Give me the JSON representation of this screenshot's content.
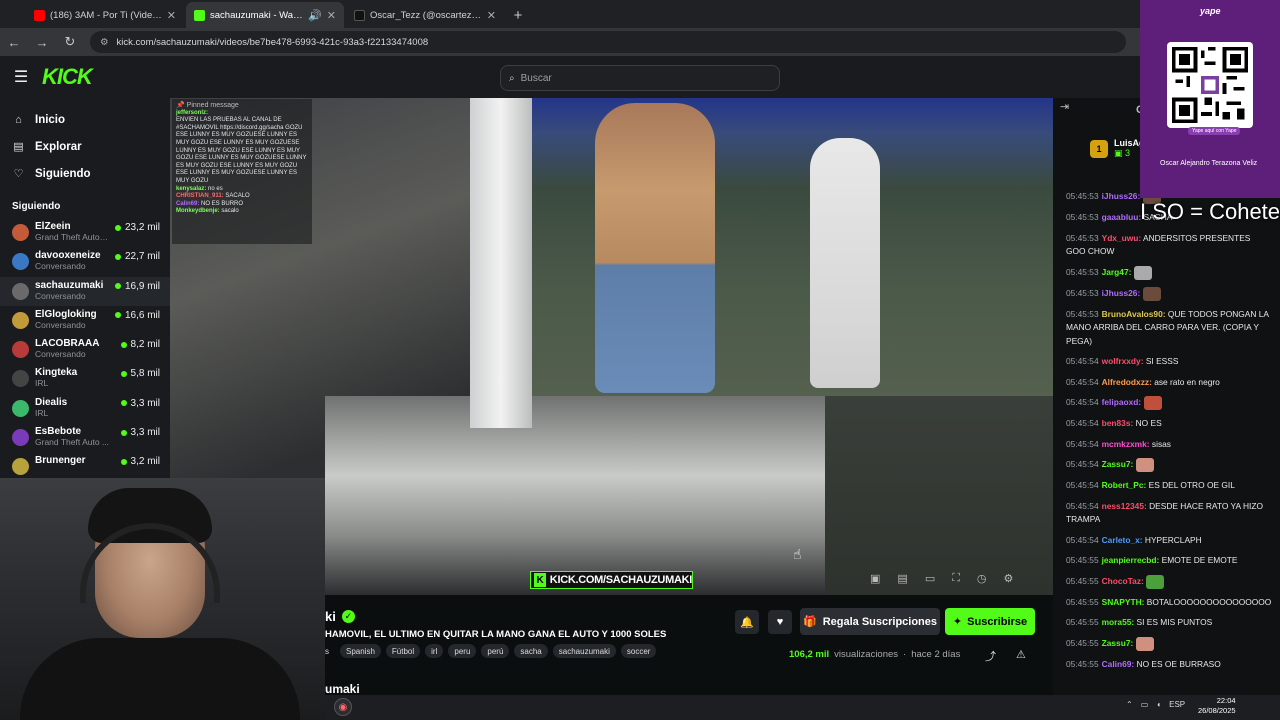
{
  "browser": {
    "tabs": [
      {
        "label": "(186) 3AM - Por Ti (Video Oficial)",
        "color": "#ff0000"
      },
      {
        "label": "sachauzumaki - Watch the",
        "color": "#53fc18"
      },
      {
        "label": "Oscar_Tezz (@oscartezz_) | TikTok",
        "color": "#111111"
      }
    ],
    "url": "kick.com/sachauzumaki/videos/be7be478-6993-421c-93a3-f22133474008"
  },
  "header": {
    "logo": "KICK",
    "search_placeholder": "Buscar"
  },
  "sidebar": {
    "nav": [
      {
        "label": "Inicio",
        "icon": "home-icon"
      },
      {
        "label": "Explorar",
        "icon": "compass-icon"
      },
      {
        "label": "Siguiendo",
        "icon": "heart-icon"
      }
    ],
    "section_title": "Siguiendo",
    "channels": [
      {
        "name": "ElZeein",
        "sub": "Grand Theft Auto ...",
        "viewers": "23,2 mil",
        "color": "#c35b3b"
      },
      {
        "name": "davooxeneize",
        "sub": "Conversando",
        "viewers": "22,7 mil",
        "color": "#3b78c3"
      },
      {
        "name": "sachauzumaki",
        "sub": "Conversando",
        "viewers": "16,9 mil",
        "color": "#6a6a6a"
      },
      {
        "name": "ElGlogloking",
        "sub": "Conversando",
        "viewers": "16,6 mil",
        "color": "#c39a3b"
      },
      {
        "name": "LACOBRAAA",
        "sub": "Conversando",
        "viewers": "8,2 mil",
        "color": "#b83b3b"
      },
      {
        "name": "Kingteka",
        "sub": "IRL",
        "viewers": "5,8 mil",
        "color": "#444444"
      },
      {
        "name": "Diealis",
        "sub": "IRL",
        "viewers": "3,3 mil",
        "color": "#3bb86a"
      },
      {
        "name": "EsBebote",
        "sub": "Grand Theft Auto ...",
        "viewers": "3,3 mil",
        "color": "#7b3bb8"
      },
      {
        "name": "Brunenger",
        "sub": "",
        "viewers": "3,2 mil",
        "color": "#b8a23b"
      }
    ]
  },
  "pinned": {
    "title": "Pinned message",
    "user": "jeffersonlz:",
    "text": "ENVIEN LAS PRUEBAS AL CANAL DE #SACHAMOVIL https://discord.gg/sacha GOZU ESE LUNNY ES MUY GOZUESE LUNNY ES MUY GOZU ESE LUNNY ES MUY GOZUESE LUNNY ES MUY GOZU ESE LUNNY ES MUY GOZU ESE LUNNY ES MUY GOZUESE LUNNY ES MUY GOZU ESE LUNNY ES MUY GOZU ESE LUNNY ES MUY GOZUESE LUNNY ES MUY GOZU",
    "extra": [
      {
        "user": "kenysalaz:",
        "text": "no es"
      },
      {
        "user": "CHRISTIAN_911:",
        "text": "SACALO"
      },
      {
        "user": "Calin69:",
        "text": "NO ES BURRO"
      },
      {
        "user": "Monkeydbenje:",
        "text": "sacalo"
      }
    ]
  },
  "video": {
    "watermark": "KICK.COM/SACHAUZUMAKI"
  },
  "stream": {
    "streamer": "ki",
    "title": "HAMOVIL, EL ULTIMO EN QUITAR LA MANO GANA EL AUTO Y 1000 SOLES",
    "tags": [
      "s",
      "Spanish",
      "Fútbol",
      "irl",
      "peru",
      "perú",
      "sacha",
      "sachauzumaki",
      "soccer"
    ],
    "gift_label": "Regala Suscripciones",
    "subscribe_label": "Suscribirse",
    "views": "106,2 mil",
    "views_label": "visualizaciones",
    "age": "hace 2 días",
    "bottom_name": "umaki"
  },
  "chat": {
    "top_label": "C",
    "pinned_user": "LuisAg",
    "pinned_count": "3",
    "messages": [
      {
        "ts": "05:45:53",
        "user": "iJhuss26:",
        "text": "",
        "color": "#b26bff",
        "emote": "#6b4b3b"
      },
      {
        "ts": "05:45:53",
        "user": "gaaabluu:",
        "text": "SACHA",
        "color": "#b26bff"
      },
      {
        "ts": "05:45:53",
        "user": "Ydx_uwu:",
        "text": "ANDERSITOS PRESENTES GOO CHOW",
        "color": "#ff4b6b"
      },
      {
        "ts": "05:45:53",
        "user": "Jarg47:",
        "text": "",
        "color": "#53fc18",
        "emote": "#aaaaaa"
      },
      {
        "ts": "05:45:53",
        "user": "iJhuss26:",
        "text": "",
        "color": "#b26bff",
        "emote": "#6b4b3b"
      },
      {
        "ts": "05:45:53",
        "user": "BrunoAvalos90:",
        "text": "QUE TODOS PONGAN LA MANO ARRIBA DEL CARRO PARA VER. (COPIA Y PEGA)",
        "color": "#e0c84b"
      },
      {
        "ts": "05:45:54",
        "user": "wolfrxxdy:",
        "text": "SI ESSS",
        "color": "#ff4b6b"
      },
      {
        "ts": "05:45:54",
        "user": "Alfredodxzz:",
        "text": "ase rato en negro",
        "color": "#ff9b4b"
      },
      {
        "ts": "05:45:54",
        "user": "felipaoxd:",
        "text": "",
        "color": "#b26bff",
        "emote": "#c0503b"
      },
      {
        "ts": "05:45:54",
        "user": "ben83s:",
        "text": "NO ES",
        "color": "#ff4b6b"
      },
      {
        "ts": "05:45:54",
        "user": "mcmkzxmk:",
        "text": "sisas",
        "color": "#ff4bd0"
      },
      {
        "ts": "05:45:54",
        "user": "Zassu7:",
        "text": "",
        "color": "#53fc18",
        "emote": "#d09080"
      },
      {
        "ts": "05:45:54",
        "user": "Robert_Pc:",
        "text": "ES DEL OTRO OE GIL",
        "color": "#53fc18"
      },
      {
        "ts": "05:45:54",
        "user": "ness12345:",
        "text": "DESDE HACE RATO YA HIZO TRAMPA",
        "color": "#ff4b6b"
      },
      {
        "ts": "05:45:54",
        "user": "Carleto_x:",
        "text": "HYPERCLAPH",
        "color": "#4b9bff"
      },
      {
        "ts": "05:45:55",
        "user": "jeanpierrecbd:",
        "text": "EMOTE DE EMOTE",
        "color": "#53fc18"
      },
      {
        "ts": "05:45:55",
        "user": "ChocoTaz:",
        "text": "",
        "color": "#ff4b6b",
        "emote": "#4ba03b"
      },
      {
        "ts": "05:45:55",
        "user": "SNAPYTH:",
        "text": "BOTALOOOOOOOOOOOOOOO",
        "color": "#53fc18"
      },
      {
        "ts": "05:45:55",
        "user": "mora55:",
        "text": "SI ES MIS PUNTOS",
        "color": "#53fc18"
      },
      {
        "ts": "05:45:55",
        "user": "Zassu7:",
        "text": "",
        "color": "#53fc18",
        "emote": "#d09080"
      },
      {
        "ts": "05:45:55",
        "user": "Calin69:",
        "text": "NO ES OE BURRASO",
        "color": "#b26bff"
      }
    ]
  },
  "overlay": {
    "qr_logo": "yape",
    "qr_caption": "Yape aquí con Yape",
    "qr_name": "Oscar Alejandro Terazona Veliz",
    "side_text": "I SO = Cohete"
  },
  "taskbar": {
    "lang": "ESP",
    "time": "22:04",
    "date": "26/08/2025"
  }
}
